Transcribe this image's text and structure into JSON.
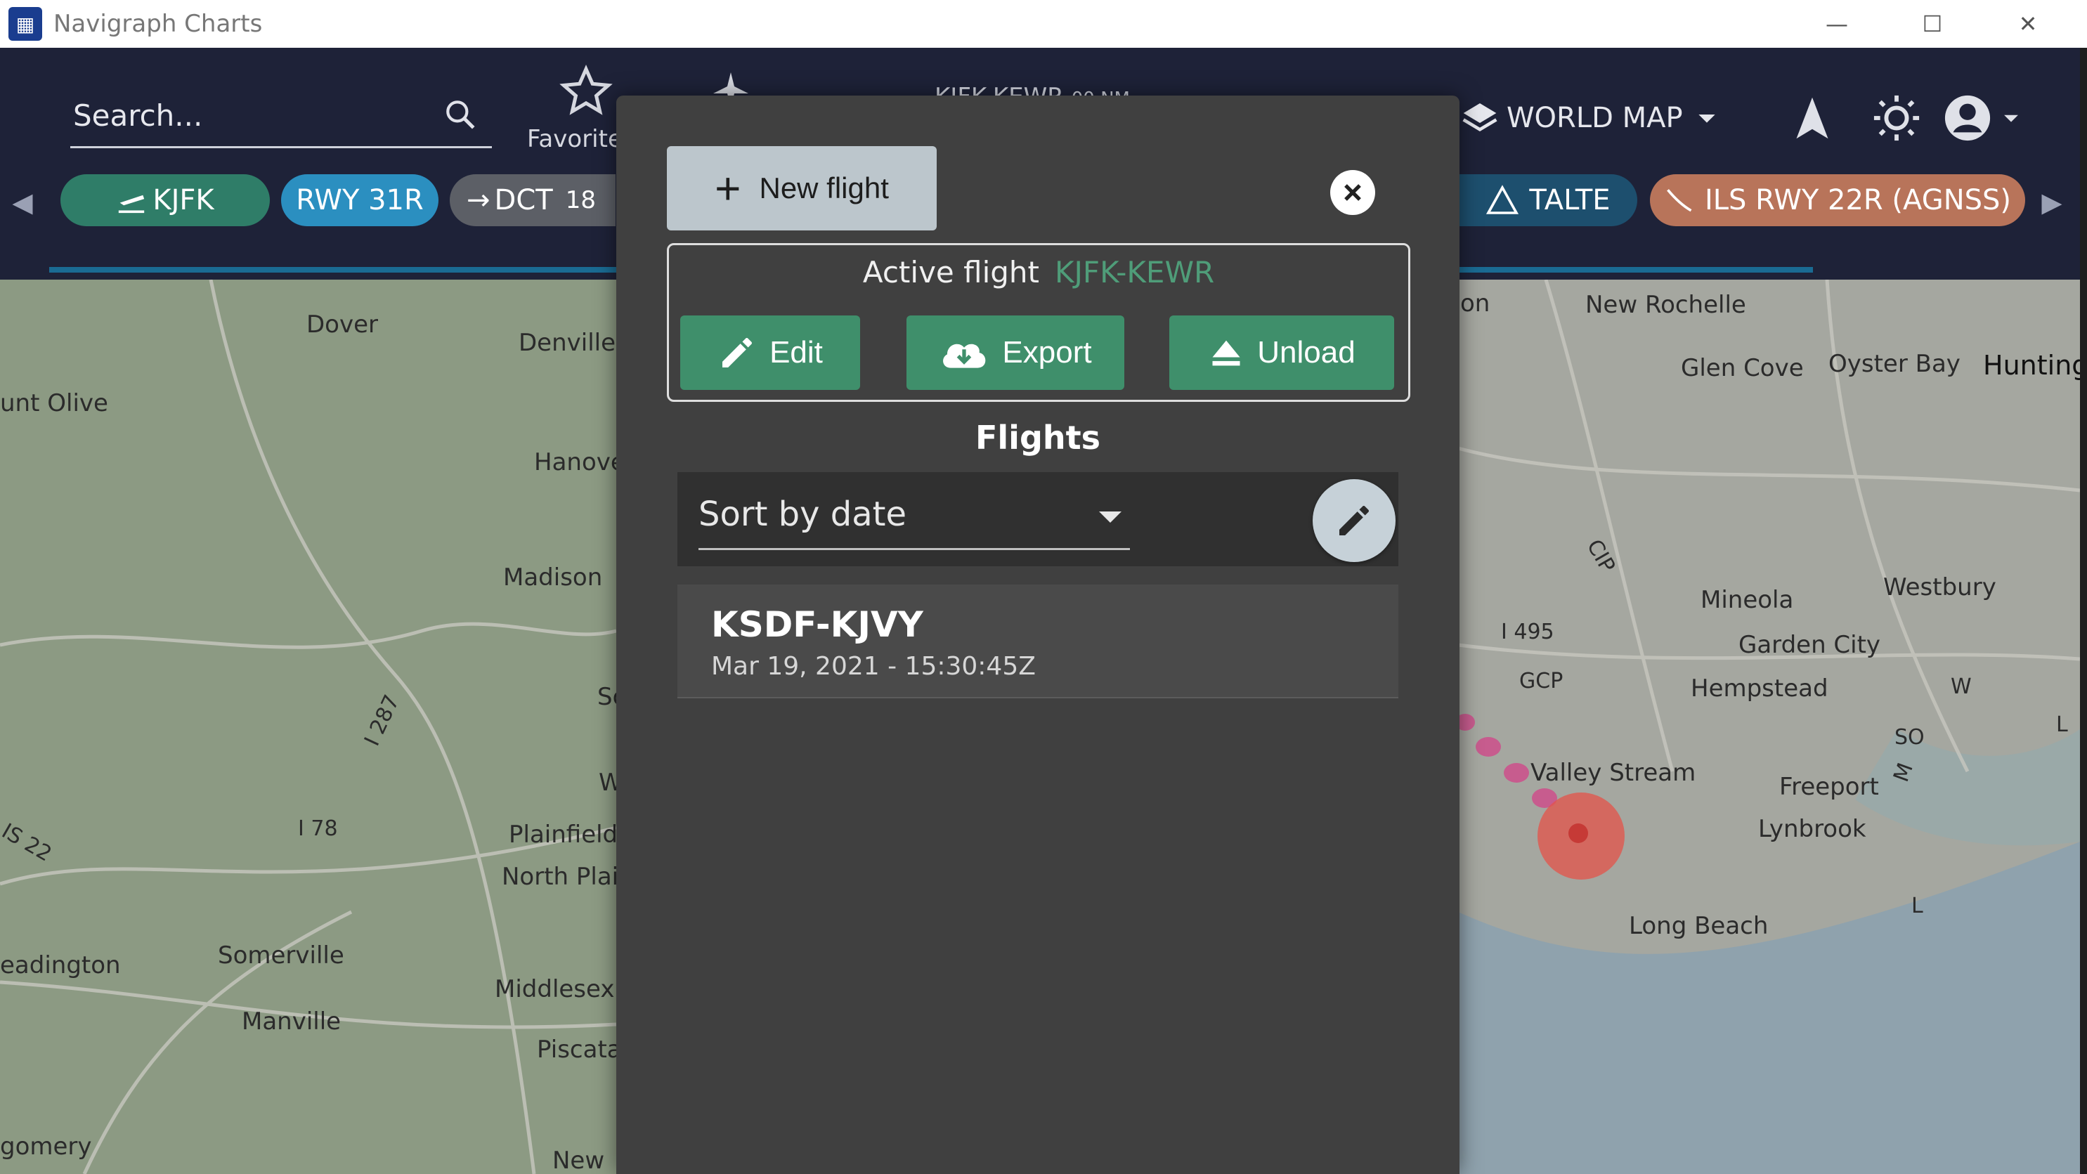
{
  "window": {
    "title": "Navigraph Charts",
    "controls": [
      "minimize",
      "maximize",
      "close"
    ]
  },
  "toolbar": {
    "search_placeholder": "Search...",
    "favorites_label": "Favorite",
    "route_partial": "KJFK-KEWR",
    "distance_partial": "00 NM",
    "layer_label": "WORLD MAP"
  },
  "chips": [
    {
      "icon": "takeoff-icon",
      "label": "KJFK",
      "color": "#2f7d68"
    },
    {
      "icon": "",
      "label": "RWY 31R",
      "color": "#2b8fc0"
    },
    {
      "icon": "arrow-right-icon",
      "label": "DCT",
      "suffix": "18",
      "color": "#5c5f66"
    },
    {
      "icon": "triangle-icon",
      "label": "TALTE",
      "color": "#1d4f6e"
    },
    {
      "icon": "approach-icon",
      "label": "ILS RWY 22R (AGNSS)",
      "color": "#b8745a"
    }
  ],
  "dialog": {
    "new_flight_label": "New flight",
    "active_flight_label": "Active flight",
    "active_flight_route": "KJFK-KEWR",
    "edit_label": "Edit",
    "export_label": "Export",
    "unload_label": "Unload",
    "flights_heading": "Flights",
    "sort_label": "Sort by date",
    "flights": [
      {
        "route": "KSDF-KJVY",
        "date": "Mar 19, 2021 - 15:30:45Z"
      }
    ]
  },
  "map": {
    "labels_left": [
      "Dover",
      "Denville",
      "unt Olive",
      "Hanove",
      "Madison",
      "Sc",
      "W",
      "Plainfield",
      "North Plai",
      "Somerville",
      "eadington",
      "Middlesex",
      "Manville",
      "Piscata",
      "gomery",
      "New",
      "I 287",
      "I 78",
      "IS 22"
    ],
    "labels_right": [
      "on",
      "New Rochelle",
      "Glen Cove",
      "Oyster Bay",
      "Hunting",
      "CIP",
      "Mineola",
      "Westbury",
      "I 495",
      "Garden City",
      "GCP",
      "Hempstead",
      "W",
      "SO",
      "Valley Stream",
      "Freeport",
      "M",
      "Lynbrook",
      "L",
      "Long Beach",
      "L"
    ]
  }
}
